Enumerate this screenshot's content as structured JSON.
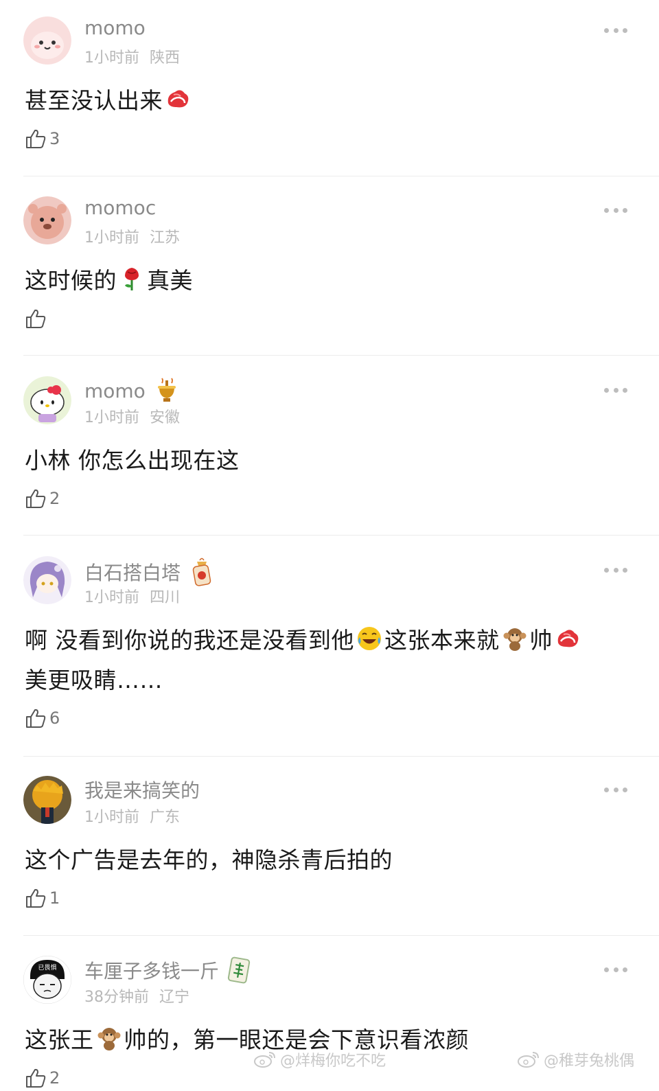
{
  "comments": [
    {
      "username": "momo",
      "time": "1小时前",
      "location": "陕西",
      "text_parts": [
        "甚至没认出来"
      ],
      "likes": "3"
    },
    {
      "username": "momoc",
      "time": "1小时前",
      "location": "江苏",
      "text_parts": [
        "这时候的",
        "真美"
      ],
      "likes": ""
    },
    {
      "username": "momo",
      "time": "1小时前",
      "location": "安徽",
      "text_parts": [
        "小林 你怎么出现在这"
      ],
      "likes": "2"
    },
    {
      "username": "白石搭白塔",
      "time": "1小时前",
      "location": "四川",
      "text_parts": [
        "啊 没看到你说的我还是没看到他",
        "这张本来就",
        "帅",
        "美更吸睛……"
      ],
      "likes": "6"
    },
    {
      "username": "我是来搞笑的",
      "time": "1小时前",
      "location": "广东",
      "text_parts": [
        "这个广告是去年的，神隐杀青后拍的"
      ],
      "likes": "1"
    },
    {
      "username": "车厘子多钱一斤",
      "time": "38分钟前",
      "location": "辽宁",
      "text_parts": [
        "这张王",
        "帅的，第一眼还是会下意识看浓颜"
      ],
      "likes": "2",
      "avatar_text": "已畏惧"
    }
  ],
  "watermarks": [
    "@烊梅你吃不吃",
    "@稚芽兔桃偶"
  ],
  "colors": {
    "username": "#8a8a8a",
    "meta": "#b8b8b8",
    "text": "#1a1a1a",
    "divider": "#ececec"
  },
  "icons": {
    "like": "thumbs-up-icon",
    "more": "more-dots-icon",
    "meat": "meat-emoji-icon",
    "rose": "rose-emoji-icon",
    "laugh": "laugh-cry-emoji-icon",
    "monkey": "monkey-emoji-icon"
  }
}
